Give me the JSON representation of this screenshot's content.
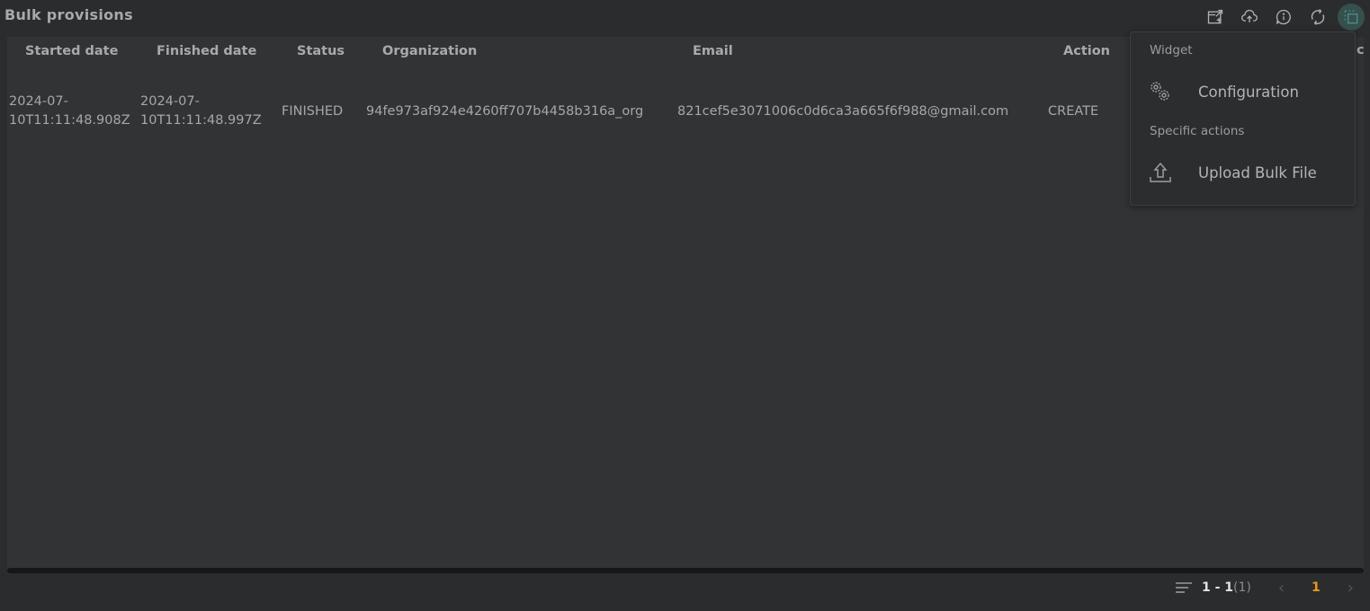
{
  "widget": {
    "title": "Bulk provisions"
  },
  "toolbar": {
    "buttons": [
      {
        "name": "export-icon"
      },
      {
        "name": "cloud-upload-icon"
      },
      {
        "name": "info-icon"
      },
      {
        "name": "refresh-icon"
      },
      {
        "name": "widget-menu-icon"
      }
    ]
  },
  "table": {
    "columns": [
      "Started date",
      "Finished date",
      "Status",
      "Organization",
      "Email",
      "Action"
    ],
    "peek_column": "c",
    "rows": [
      {
        "started_line1": "2024-07-",
        "started_line2": "10T11:11:48.908Z",
        "finished_line1": "2024-07-",
        "finished_line2": "10T11:11:48.997Z",
        "status": "FINISHED",
        "organization": "94fe973af924e4260ff707b4458b316a_org",
        "email": "821cef5e3071006c0d6ca3a665f6f988@gmail.com",
        "action": "CREATE"
      }
    ]
  },
  "pagination": {
    "range": "1 - 1",
    "total": "(1)",
    "current_page": "1",
    "prev": "‹",
    "next": "›"
  },
  "menu": {
    "section1": "Widget",
    "item1": "Configuration",
    "section2": "Specific actions",
    "item2": "Upload Bulk File"
  },
  "colors": {
    "accent": "#e69a1a",
    "active_button": "#4d8e88"
  }
}
